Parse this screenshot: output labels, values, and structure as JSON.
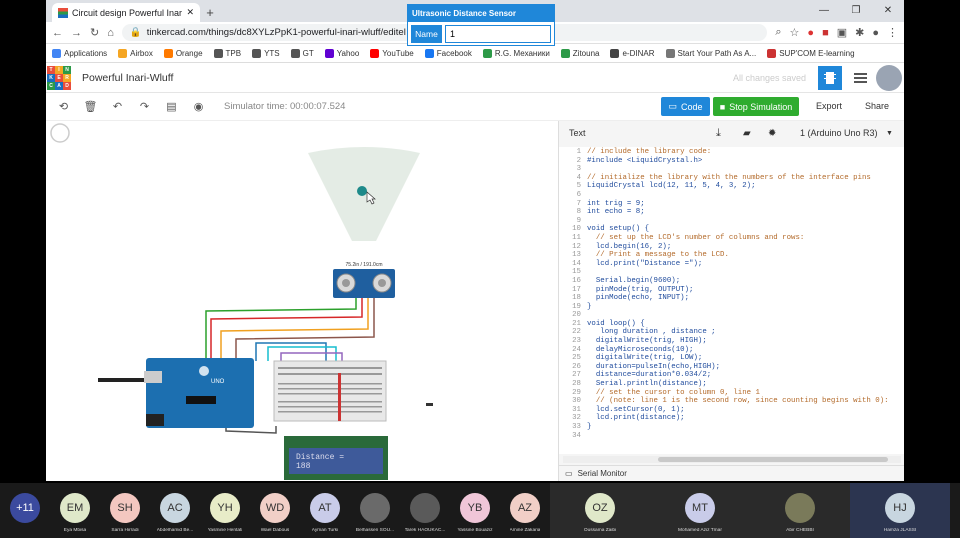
{
  "browser": {
    "tab_title": "Circuit design Powerful Inari-Wl...",
    "url": "tinkercad.com/things/dc8XYLzPpK1-powerful-inari-wluff/editel",
    "bookmarks": [
      "Applications",
      "Airbox",
      "Orange",
      "TPB",
      "YTS",
      "GT",
      "Yahoo",
      "YouTube",
      "Facebook",
      "R.G. Механики",
      "Zitouna",
      "e-DINAR",
      "Start Your Path As A...",
      "SUP'COM E-learning"
    ]
  },
  "app": {
    "logo_letters": [
      "TIN",
      "KER",
      "CAD"
    ],
    "project_name": "Powerful Inari-Wluff",
    "save_status": "All changes saved",
    "sim_time": "Simulator time: 00:00:07.524",
    "code_label": "Code",
    "stop_label": "Stop Simulation",
    "export_label": "Export",
    "share_label": "Share"
  },
  "sensor_panel": {
    "title": "Ultrasonic Distance Sensor",
    "name_label": "Name",
    "name_value": "1"
  },
  "sensor_readout": "75.2in / 191.0cm",
  "lcd": {
    "line1": "Distance =",
    "line2": "188"
  },
  "code_panel": {
    "mode": "Text",
    "device": "1 (Arduino Uno R3)",
    "serial_label": "Serial Monitor",
    "lines": [
      "// include the library code:",
      "#include <LiquidCrystal.h>",
      "",
      "// initialize the library with the numbers of the interface pins",
      "LiquidCrystal lcd(12, 11, 5, 4, 3, 2);",
      "",
      "int trig = 9;",
      "int echo = 8;",
      "",
      "void setup() {",
      "  // set up the LCD's number of columns and rows:",
      "  lcd.begin(16, 2);",
      "  // Print a message to the LCD.",
      "  lcd.print(\"Distance =\");",
      "",
      "  Serial.begin(9600);",
      "  pinMode(trig, OUTPUT);",
      "  pinMode(echo, INPUT);",
      "}",
      "",
      "void loop() {",
      "   long duration , distance ;",
      "  digitalWrite(trig, HIGH);",
      "  delayMicroseconds(10);",
      "  digitalWrite(trig, LOW);",
      "  duration=pulseIn(echo,HIGH);",
      "  distance=duration*0.034/2;",
      "  Serial.println(distance);",
      "  // set the cursor to column 0, line 1",
      "  // (note: line 1 is the second row, since counting begins with 0):",
      "  lcd.setCursor(0, 1);",
      "  lcd.print(distance);",
      "}",
      ""
    ]
  },
  "participants": [
    {
      "initials": "+11",
      "name": "",
      "color": "#3b4a9e"
    },
    {
      "initials": "EM",
      "name": "Eya Mbisa",
      "color": "#dfe8c9"
    },
    {
      "initials": "SH",
      "name": "Sarra Hirradi",
      "color": "#f3c7c0"
    },
    {
      "initials": "AC",
      "name": "Abdelhamid Be...",
      "color": "#c8d6e0"
    },
    {
      "initials": "YH",
      "name": "Yasmine Hentati",
      "color": "#e8ecc8"
    },
    {
      "initials": "WD",
      "name": "Wael Dabous",
      "color": "#f1cfc7"
    },
    {
      "initials": "AT",
      "name": "Ayman Turki",
      "color": "#c9cce9"
    },
    {
      "initials": "",
      "name": "Belhassen SOU...",
      "color": "#6a6a6a"
    },
    {
      "initials": "",
      "name": "Tarek HAOUKAC...",
      "color": "#5a5a5a"
    },
    {
      "initials": "YB",
      "name": "Yassine Bouaziz",
      "color": "#f0c6d8"
    },
    {
      "initials": "AZ",
      "name": "Amine Zakaria",
      "color": "#f1cfc7"
    },
    {
      "initials": "OZ",
      "name": "Oussama Zaibi",
      "color": "#dfe8c9"
    },
    {
      "initials": "MT",
      "name": "Mohamed Aziz Tmar",
      "color": "#c9cce9"
    },
    {
      "initials": "",
      "name": "Abir CHEBBI",
      "color": "#7a7a5a"
    },
    {
      "initials": "HJ",
      "name": "Hamza JLASSI",
      "color": "#c8d6e0"
    }
  ]
}
